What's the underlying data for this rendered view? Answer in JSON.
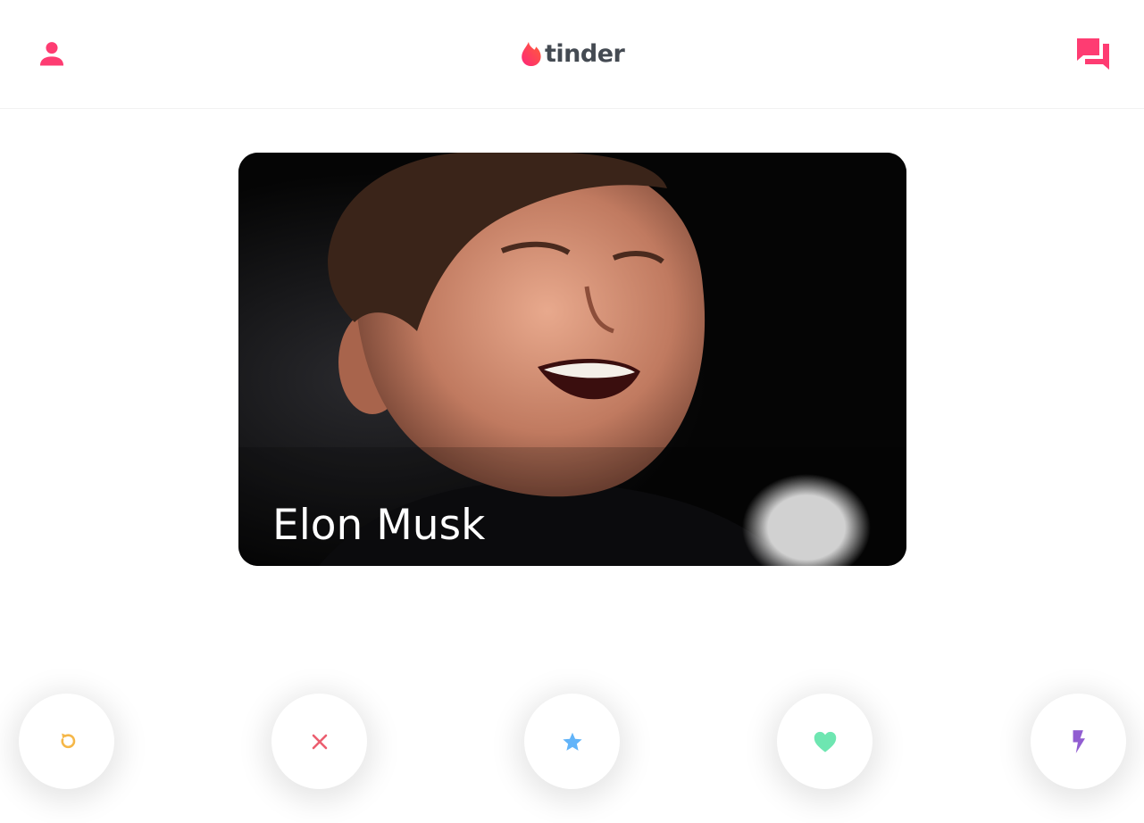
{
  "header": {
    "profile_icon": "person-icon",
    "logo_icon": "flame-icon",
    "logo_text": "tinder",
    "chat_icon": "chat-bubbles-icon",
    "accent_color": "#fe3c72"
  },
  "card": {
    "name": "Elon Musk",
    "photo": "photo of a smiling man against a dark background with a bright light"
  },
  "actions": [
    {
      "name": "rewind",
      "icon": "rewind-icon",
      "color": "#f5b748"
    },
    {
      "name": "nope",
      "icon": "close-icon",
      "color": "#ec5e6f"
    },
    {
      "name": "super-like",
      "icon": "star-icon",
      "color": "#62b4f9"
    },
    {
      "name": "like",
      "icon": "heart-icon",
      "color": "#3ca4ff"
    },
    {
      "name": "boost",
      "icon": "lightning-icon",
      "color": "#915dd1"
    }
  ]
}
